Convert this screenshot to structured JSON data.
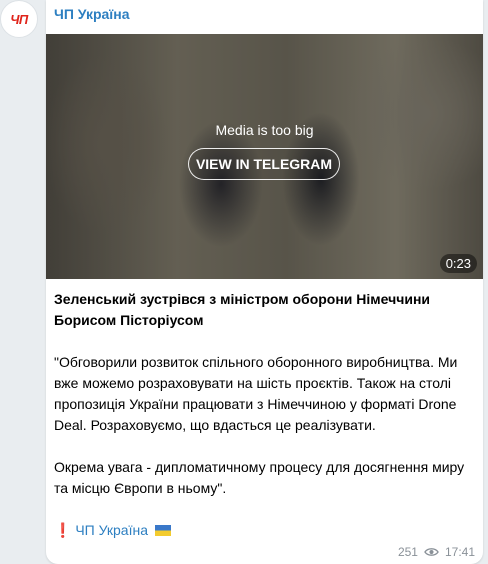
{
  "channel": {
    "name": "ЧП Україна",
    "avatar_text": "ЧП",
    "avatar_icon": "channel-logo-icon"
  },
  "media": {
    "notice": "Media is too big",
    "button_label": "VIEW IN TELEGRAM",
    "duration": "0:23"
  },
  "post": {
    "headline": "Зеленський зустрівся з міністром оборони Німеччини Борисом Пісторіусом",
    "quote_1": "\"Обговорили розвиток спільного оборонного виробництва. Ми вже можемо розраховувати на шість проєктів. Також на столі пропозиція України працювати з Німеччиною у форматі Drone Deal. Розраховуємо, що вдасться це реалізувати.",
    "quote_2": "Окрема увага - дипломатичному процесу для досягнення миру та місцю Європи в ньому\".",
    "signature_mark": "❗",
    "signature_link": "ЧП Україна",
    "signature_flag_icon": "ukraine-flag-icon"
  },
  "footer": {
    "views": "251",
    "views_icon": "eye-icon",
    "time": "17:41"
  },
  "colors": {
    "link": "#2d7fc1",
    "background": "#e9edf0",
    "bubble": "#ffffff",
    "meta": "#8a9198",
    "brand_red": "#e0241b"
  }
}
